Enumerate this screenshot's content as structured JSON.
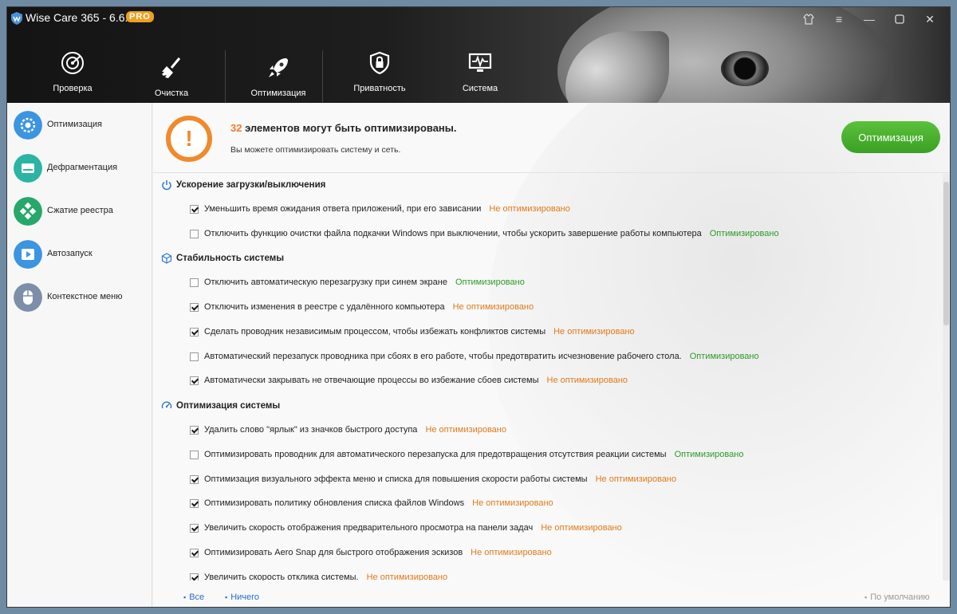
{
  "app": {
    "title": "Wise Care 365 - 6.6.3",
    "badge": "PRO"
  },
  "nav": {
    "tabs": [
      {
        "label": "Проверка",
        "icon": "radar-icon"
      },
      {
        "label": "Очистка",
        "icon": "broom-icon"
      },
      {
        "label": "Оптимизация",
        "icon": "rocket-icon",
        "selected": true
      },
      {
        "label": "Приватность",
        "icon": "shield-lock-icon"
      },
      {
        "label": "Система",
        "icon": "monitor-pulse-icon"
      }
    ]
  },
  "sidebar": {
    "items": [
      {
        "label": "Оптимизация",
        "icon": "gear-icon",
        "selected": true
      },
      {
        "label": "Дефрагментация",
        "icon": "disk-icon"
      },
      {
        "label": "Сжатие реестра",
        "icon": "registry-icon"
      },
      {
        "label": "Автозапуск",
        "icon": "play-icon"
      },
      {
        "label": "Контекстное меню",
        "icon": "mouse-icon"
      }
    ]
  },
  "summary": {
    "count": "32",
    "headline": " элементов могут быть оптимизированы.",
    "subtitle": "Вы можете оптимизировать систему и сеть.",
    "button": "Оптимизация"
  },
  "status_labels": {
    "not_optimized": "Не оптимизировано",
    "optimized": "Оптимизировано"
  },
  "sections": [
    {
      "title": "Ускорение загрузки/выключения",
      "icon": "power-icon",
      "items": [
        {
          "text": "Уменьшить время ожидания ответа приложений, при его зависании",
          "checked": true,
          "status": "Не оптимизировано"
        },
        {
          "text": "Отключить функцию очистки файла подкачки Windows при выключении, чтобы ускорить завершение работы компьютера",
          "checked": false,
          "status": "Оптимизировано"
        }
      ]
    },
    {
      "title": "Стабильность системы",
      "icon": "cube-icon",
      "items": [
        {
          "text": "Отключить автоматическую перезагрузку при синем экране",
          "checked": false,
          "status": "Оптимизировано"
        },
        {
          "text": "Отключить изменения в реестре с удалённого компьютера",
          "checked": true,
          "status": "Не оптимизировано"
        },
        {
          "text": "Сделать проводник независимым процессом, чтобы избежать конфликтов системы",
          "checked": true,
          "status": "Не оптимизировано"
        },
        {
          "text": "Автоматический перезапуск проводника при сбоях в его работе, чтобы предотвратить исчезновение рабочего стола.",
          "checked": false,
          "status": "Оптимизировано"
        },
        {
          "text": "Автоматически закрывать не отвечающие процессы во избежание сбоев системы",
          "checked": true,
          "status": "Не оптимизировано"
        }
      ]
    },
    {
      "title": "Оптимизация системы",
      "icon": "speedometer-icon",
      "items": [
        {
          "text": "Удалить слово \"ярлык\" из значков быстрого доступа",
          "checked": true,
          "status": "Не оптимизировано"
        },
        {
          "text": "Оптимизировать проводник для автоматического перезапуска для предотвращения отсутствия реакции системы",
          "checked": false,
          "status": "Оптимизировано"
        },
        {
          "text": "Оптимизация визуального эффекта меню и списка для повышения скорости работы системы",
          "checked": true,
          "status": "Не оптимизировано"
        },
        {
          "text": "Оптимизировать политику обновления списка файлов Windows",
          "checked": true,
          "status": "Не оптимизировано"
        },
        {
          "text": "Увеличить скорость отображения предварительного просмотра на панели задач",
          "checked": true,
          "status": "Не оптимизировано"
        },
        {
          "text": "Оптимизировать Aero Snap для быстрого отображения эскизов",
          "checked": true,
          "status": "Не оптимизировано"
        },
        {
          "text": "Увеличить скорость отклика системы.",
          "checked": true,
          "status": "Не оптимизировано"
        }
      ]
    }
  ],
  "footer": {
    "all": "Все",
    "none": "Ничего",
    "default": "По умолчанию"
  },
  "colors": {
    "accent_orange": "#f08a2c",
    "not_optimized": "#e07a1a",
    "optimized": "#2f9a2a",
    "button_green": "#4cb232",
    "link_blue": "#2a6cc8"
  }
}
